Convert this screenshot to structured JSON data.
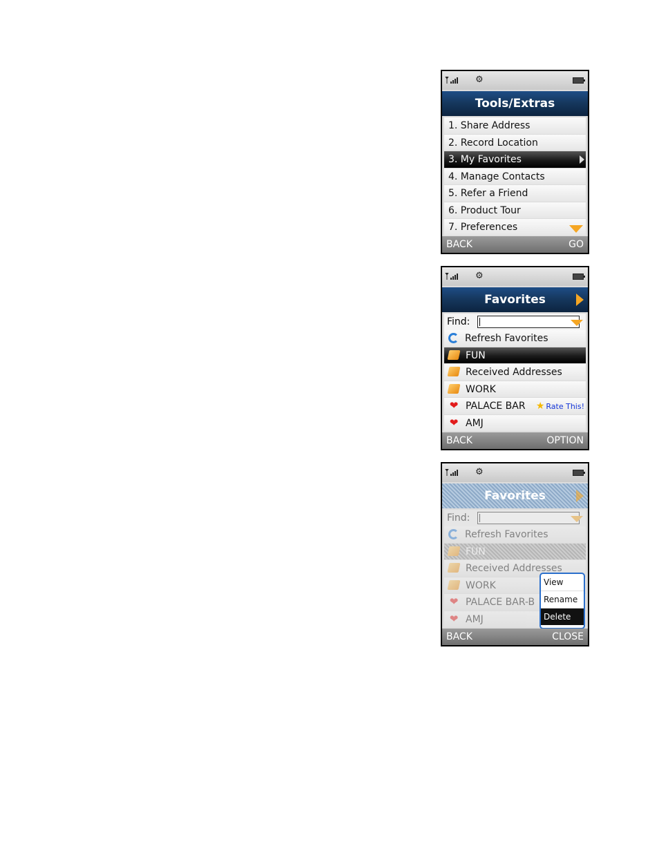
{
  "screens": [
    {
      "status": {
        "signal_icon": "signal-bars-icon",
        "settings_icon": "gear-icon",
        "battery_icon": "battery-icon"
      },
      "title": "Tools/Extras",
      "items": [
        {
          "label": "1. Share Address"
        },
        {
          "label": "2. Record Location"
        },
        {
          "label": "3. My Favorites",
          "selected": true
        },
        {
          "label": "4. Manage Contacts"
        },
        {
          "label": "5. Refer a Friend"
        },
        {
          "label": "6. Product Tour"
        },
        {
          "label": "7. Preferences"
        }
      ],
      "softkeys": {
        "left": "BACK",
        "right": "GO"
      }
    },
    {
      "title": "Favorites",
      "find_label": "Find:",
      "items": [
        {
          "label": "Refresh Favorites",
          "icon": "refresh-icon"
        },
        {
          "label": "FUN",
          "icon": "folder-icon",
          "selected": true
        },
        {
          "label": "Received Addresses",
          "icon": "folder-icon"
        },
        {
          "label": "WORK",
          "icon": "folder-icon"
        },
        {
          "label": "PALACE BAR",
          "icon": "heart-icon",
          "extra": "Rate This!"
        },
        {
          "label": "AMJ",
          "icon": "heart-icon"
        }
      ],
      "softkeys": {
        "left": "BACK",
        "right": "OPTION"
      }
    },
    {
      "title": "Favorites",
      "find_label": "Find:",
      "items": [
        {
          "label": "Refresh Favorites",
          "icon": "refresh-icon"
        },
        {
          "label": "FUN",
          "icon": "folder-icon",
          "selected": true
        },
        {
          "label": "Received Addresses",
          "icon": "folder-icon"
        },
        {
          "label": "WORK",
          "icon": "folder-icon"
        },
        {
          "label": "PALACE BAR-B",
          "icon": "heart-icon"
        },
        {
          "label": "AMJ",
          "icon": "heart-icon"
        }
      ],
      "popup": [
        "View",
        "Rename",
        "Delete"
      ],
      "popup_selected": "Delete",
      "softkeys": {
        "left": "BACK",
        "right": "CLOSE"
      }
    }
  ],
  "colors": {
    "accent": "#f5a623",
    "title_bar": "#16385f",
    "selection": "#000000",
    "popup_border": "#2a6fcc",
    "link": "#1435d8"
  }
}
